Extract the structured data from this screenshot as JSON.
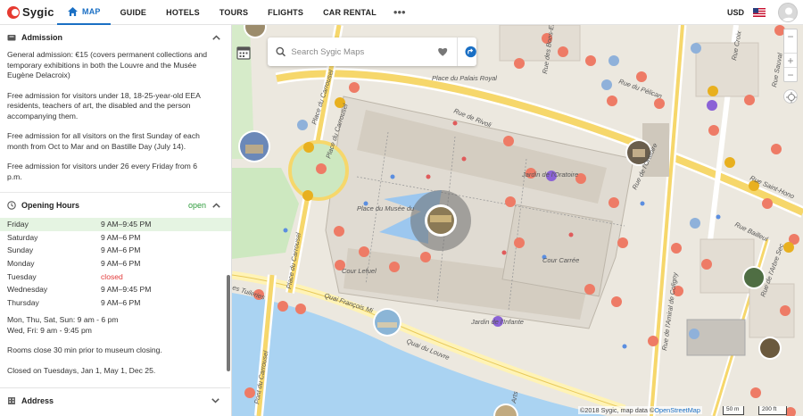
{
  "brand": {
    "name": "Sygic"
  },
  "nav": {
    "items": [
      {
        "label": "MAP",
        "icon": "home-icon",
        "active": true
      },
      {
        "label": "GUIDE"
      },
      {
        "label": "HOTELS"
      },
      {
        "label": "TOURS"
      },
      {
        "label": "FLIGHTS"
      },
      {
        "label": "CAR RENTAL"
      }
    ],
    "more": "•••"
  },
  "header_right": {
    "currency": "USD",
    "flag_icon": "us-flag-icon"
  },
  "admission": {
    "title": "Admission",
    "paragraphs": [
      "General admission: €15 (covers permanent collections and temporary exhibitions in both the Louvre and the Musée Eugène Delacroix)",
      "Free admission for visitors under 18, 18-25-year-old EEA residents, teachers of art, the disabled and the person accompanying them.",
      "Free admission for all visitors on the first Sunday of each month from Oct to Mar and on Bastille Day (July 14).",
      "Free admission for visitors under 26 every Friday from 6 p.m."
    ]
  },
  "opening_hours": {
    "title": "Opening Hours",
    "status": "open",
    "days": [
      {
        "day": "Friday",
        "time": "9 AM–9:45 PM",
        "today": true
      },
      {
        "day": "Saturday",
        "time": "9 AM–6 PM"
      },
      {
        "day": "Sunday",
        "time": "9 AM–6 PM"
      },
      {
        "day": "Monday",
        "time": "9 AM–6 PM"
      },
      {
        "day": "Tuesday",
        "time": "closed"
      },
      {
        "day": "Wednesday",
        "time": "9 AM–9:45 PM"
      },
      {
        "day": "Thursday",
        "time": "9 AM–6 PM"
      }
    ],
    "notes": [
      "Mon, Thu, Sat, Sun: 9 am - 6 pm\nWed, Fri: 9 am - 9:45 pm",
      "Rooms close 30 min prior to museum closing.",
      "Closed on Tuesdays, Jan 1, May 1, Dec 25."
    ]
  },
  "address": {
    "title": "Address"
  },
  "map": {
    "search_placeholder": "Search Sygic Maps",
    "labels": {
      "palais_royal": "Place du Palais Royal",
      "rivoli": "Rue de Rivoli",
      "carrousel1": "Place du Carrousel",
      "carrousel2": "Place du Carrousel",
      "oratoire": "Jardin de l'Oratoire",
      "musee": "Place du Musée du",
      "cour_lefuel": "Cour Lefuel",
      "cour_carree": "Cour Carrée",
      "jardin_infante": "Jardin de l'Infante",
      "quai_mitterrand": "Quai François Mi",
      "quai_louvre": "Quai du Louvre",
      "pont_carrousel": "Pont du Carrousel",
      "tuileries": "es Tuileries",
      "amiral": "Rue de l'Amiral de Coligny",
      "arbre_sec": "Rue de l'Arbre Sec",
      "bailleul": "Rue Bailleul",
      "saint_honore": "Rue Saint-Hono",
      "pelican": "Rue du Pélican",
      "bons_enfants": "Rue des Bons-Enfants",
      "croix": "Rue Croix",
      "sauval": "Rue Sauval",
      "oratoire_st": "Rue de l'Oratoire",
      "rue_carrousel": "Place du Carrousel",
      "arts": "Arts"
    },
    "attribution_prefix": "©2018 Sygic, map data ©",
    "attribution_link": "OpenStreetMap",
    "scale_m": "50 m",
    "scale_ft": "200 ft",
    "zoom_in": "+",
    "zoom_out": "−"
  }
}
